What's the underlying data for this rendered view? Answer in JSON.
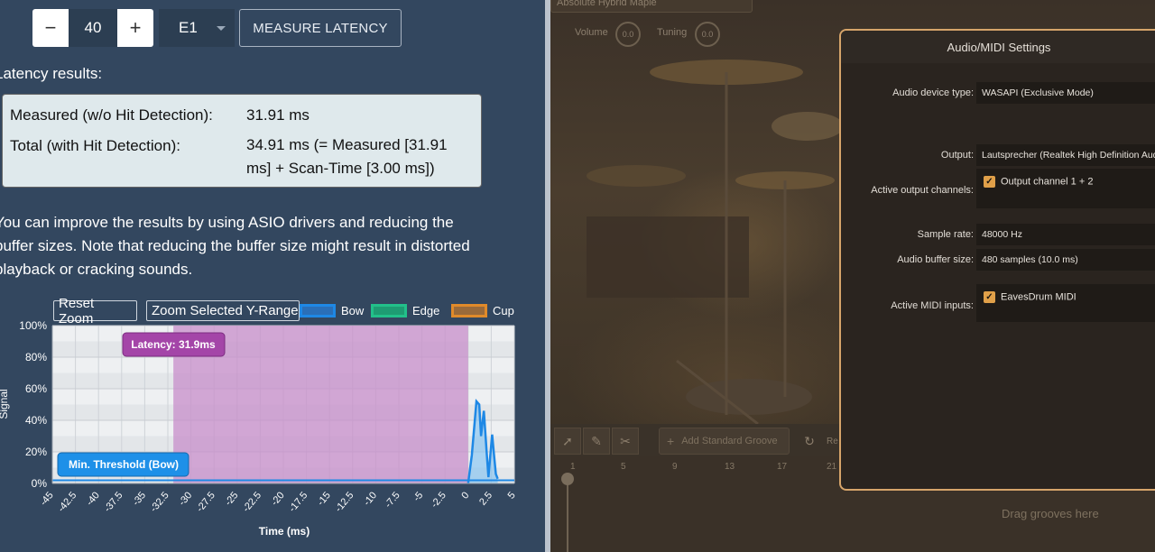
{
  "left": {
    "stepper": {
      "minus": "−",
      "value": "40",
      "plus": "+"
    },
    "select": {
      "value": "E1"
    },
    "measure_button": "MEASURE LATENCY",
    "latency_title": "Latency results:",
    "results": {
      "measured_label": "Measured (w/o Hit Detection):",
      "measured_value": "31.91 ms",
      "total_label": "Total (with Hit Detection):",
      "total_value": "34.91 ms (= Measured [31.91 ms] + Scan-Time [3.00 ms])"
    },
    "improve_text": "You can improve the results by using ASIO drivers and reducing the buffer sizes. Note that reducing the buffer size might result in distorted playback or cracking sounds.",
    "reset_zoom": "Reset Zoom",
    "zoom_y": "Zoom Selected Y-Range",
    "legend": [
      {
        "name": "Bow",
        "color": "#1e88e5"
      },
      {
        "name": "Edge",
        "color": "#22c08a"
      },
      {
        "name": "Cup",
        "color": "#e08a2a"
      }
    ],
    "latency_label": "Latency: 31.9ms",
    "threshold_label": "Min. Threshold (Bow)"
  },
  "chart_data": {
    "type": "area",
    "xlabel": "Time (ms)",
    "ylabel": "Signal",
    "xlim": [
      -45,
      5
    ],
    "ylim": [
      0,
      100
    ],
    "x_ticks": [
      "-45",
      "-42.5",
      "-40",
      "-37.5",
      "-35",
      "-32.5",
      "-30",
      "-27.5",
      "-25",
      "-22.5",
      "-20",
      "-17.5",
      "-15",
      "-12.5",
      "-10",
      "-7.5",
      "-5",
      "-2.5",
      "0",
      "2.5",
      "5"
    ],
    "y_ticks": [
      "0%",
      "20%",
      "40%",
      "60%",
      "80%",
      "100%"
    ],
    "latency_region": [
      -31.9,
      0
    ],
    "series": [
      {
        "name": "Bow",
        "x": [
          0,
          0.4,
          0.9,
          1.2,
          1.4,
          1.7,
          2.0,
          2.2,
          2.4,
          2.6,
          2.8,
          3.0,
          3.2
        ],
        "values": [
          0,
          18,
          52,
          50,
          30,
          46,
          20,
          4,
          18,
          31,
          18,
          6,
          3
        ]
      }
    ],
    "threshold": 2
  },
  "right": {
    "preset": "Absolute Hybrid Maple",
    "volume_label": "Volume",
    "volume_value": "0.0",
    "tuning_label": "Tuning",
    "tuning_value": "0.0",
    "add_groove": "Add Standard Groove",
    "re_label": "Re",
    "timeline_ticks": [
      "1",
      "5",
      "9",
      "13",
      "17",
      "21"
    ],
    "drag_grooves": "Drag grooves here",
    "dialog": {
      "title": "Audio/MIDI Settings",
      "device_type_label": "Audio device type:",
      "device_type": "WASAPI (Exclusive Mode)",
      "output_label": "Output:",
      "output": "Lautsprecher (Realtek High Definition Audio(SST))",
      "active_outputs_label": "Active output channels:",
      "active_output_channel": "Output channel 1 + 2",
      "sample_rate_label": "Sample rate:",
      "sample_rate": "48000 Hz",
      "buffer_label": "Audio buffer size:",
      "buffer": "480 samples (10.0 ms)",
      "midi_label": "Active MIDI inputs:",
      "midi_input": "EavesDrum MIDI"
    }
  }
}
